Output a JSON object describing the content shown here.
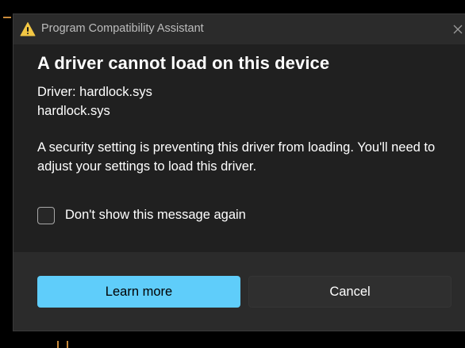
{
  "window": {
    "title": "Program Compatibility Assistant",
    "icon": "warning-icon",
    "close_icon": "close-icon"
  },
  "dialog": {
    "heading": "A driver cannot load on this device",
    "driver_line": "Driver: hardlock.sys",
    "driver_file": "hardlock.sys",
    "message": "A security setting is preventing this driver from loading. You'll need to adjust your settings to load this driver.",
    "checkbox_label": "Don't show this message again",
    "checkbox_checked": false
  },
  "buttons": {
    "learn_more": "Learn more",
    "cancel": "Cancel"
  },
  "colors": {
    "accent": "#5fcdfa",
    "dialog_bg": "#202020",
    "titlebar_bg": "#2b2b2b",
    "warning": "#f2c744"
  }
}
